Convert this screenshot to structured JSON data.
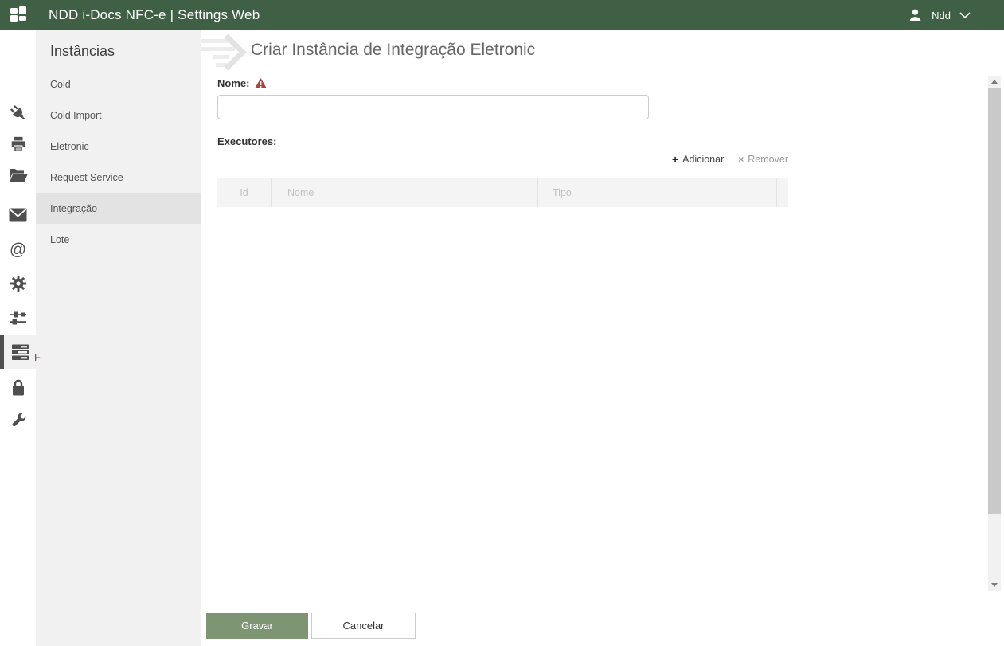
{
  "topbar": {
    "title": "NDD i-Docs NFC-e | Settings Web",
    "user_name": "Ndd"
  },
  "icon_rail": {
    "icons": [
      "plug",
      "printer",
      "folder-open",
      "envelope",
      "at-sign",
      "gear",
      "sliders",
      "server-stack",
      "lock",
      "wrench"
    ],
    "selected_icon": "server-stack"
  },
  "sidebar": {
    "title": "Instâncias",
    "items": [
      {
        "label": "Cold",
        "selected": false
      },
      {
        "label": "Cold Import",
        "selected": false
      },
      {
        "label": "Eletronic",
        "selected": false
      },
      {
        "label": "Request Service",
        "selected": false
      },
      {
        "label": "Integração",
        "selected": true
      },
      {
        "label": "Lote",
        "selected": false
      }
    ]
  },
  "clipped_fragment": {
    "text": "F"
  },
  "main": {
    "header_title": "Criar Instância de Integração Eletronic",
    "form": {
      "nome_label": "Nome:",
      "nome_value": "",
      "executores_label": "Executores:"
    },
    "actions": {
      "add_label": "Adicionar",
      "remove_label": "Remover"
    },
    "table": {
      "columns": [
        "Id",
        "Nome",
        "Tipo"
      ],
      "rows": []
    },
    "footer": {
      "save_label": "Gravar",
      "cancel_label": "Cancelar"
    }
  },
  "colors": {
    "topbar_bg": "#3f6044",
    "save_button_bg": "#7e9574",
    "warning_icon": "#a8423c",
    "sidebar_bg": "#f1f1f1",
    "selected_item_bg": "#e3e3e3",
    "selected_rail_border": "#4f4f4f"
  }
}
